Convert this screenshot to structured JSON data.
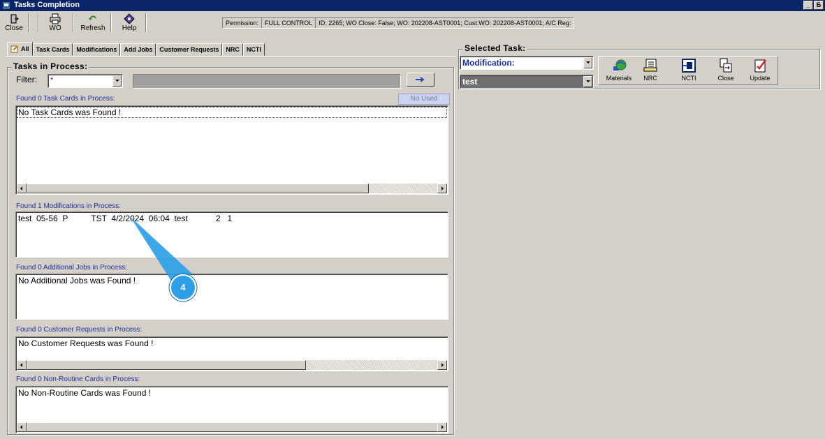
{
  "window": {
    "title": "Tasks Completion",
    "minimize": "_",
    "restore": "Б"
  },
  "toolbar": {
    "close_label": "Close",
    "wo_label": "WO",
    "refresh_label": "Refresh",
    "help_label": "Help",
    "permission_label": "Permission:",
    "permission_value": "FULL CONTROL",
    "info": "ID: 2265; WO Close: False; WO: 202208-AST0001; Cust.WO: 202208-AST0001; A/C Reg:"
  },
  "tabs": [
    {
      "label": "All",
      "active": true
    },
    {
      "label": "Task Cards"
    },
    {
      "label": "Modifications"
    },
    {
      "label": "Add Jobs"
    },
    {
      "label": "Customer Requests"
    },
    {
      "label": "NRC"
    },
    {
      "label": "NCTI"
    }
  ],
  "tasks_panel": {
    "title": "Tasks in Process:",
    "filter_label": "Filter:",
    "filter_value": "*",
    "no_used_button": "No Used",
    "sections": {
      "task_cards": {
        "label": "Found 0 Task Cards in Process:",
        "items": [
          "No Task Cards was Found !"
        ]
      },
      "modifications": {
        "label": "Found 1 Modifications in Process:",
        "items": [
          "test  05-56  P          TST  4/2/2024  06:04  test            2   1"
        ]
      },
      "additional_jobs": {
        "label": "Found 0 Additional Jobs in Process:",
        "items": [
          "No Additional Jobs was Found !"
        ]
      },
      "customer_requests": {
        "label": "Found 0 Customer Requests in Process:",
        "items": [
          "No Customer Requests was Found !"
        ]
      },
      "non_routine": {
        "label": "Found 0 Non-Routine Cards in Process:",
        "items": [
          "No Non-Routine Cards was Found !"
        ]
      }
    }
  },
  "selected_task": {
    "title": "Selected Task:",
    "type_value": "Modification:",
    "task_value": "test",
    "buttons": [
      {
        "label": "Materials",
        "icon": "materials-icon"
      },
      {
        "label": "NRC",
        "icon": "nrc-icon"
      },
      {
        "label": "NCTI",
        "icon": "ncti-icon"
      },
      {
        "label": "Close",
        "icon": "close-task-icon"
      },
      {
        "label": "Update",
        "icon": "update-icon"
      }
    ]
  },
  "annotation": {
    "number": "4",
    "color": "#2e9fe6"
  },
  "colors": {
    "titlebar": "#0a246a",
    "section_label": "#1c2fa0",
    "selected_task_bg": "#6e6e6e"
  }
}
